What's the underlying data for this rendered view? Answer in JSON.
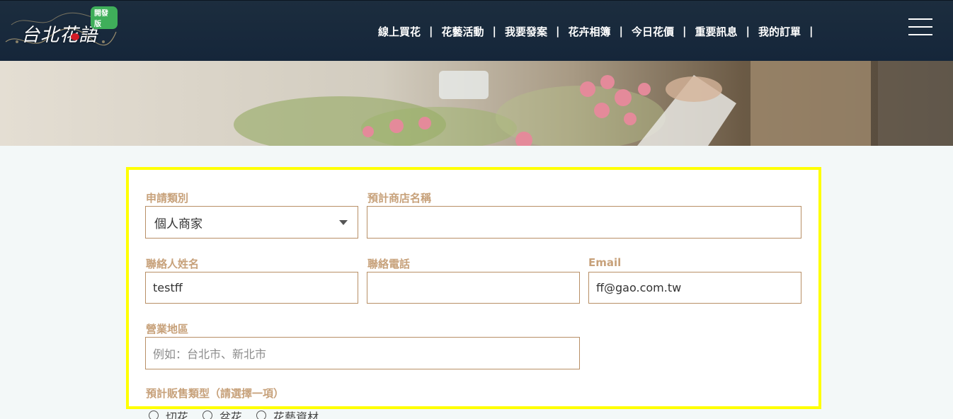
{
  "header": {
    "logo_text": "台北花語",
    "logo_badge": "開發版",
    "nav": [
      "線上買花",
      "花藝活動",
      "我要發案",
      "花卉相簿",
      "今日花價",
      "重要訊息",
      "我的訂單"
    ],
    "nav_separator": "|"
  },
  "form": {
    "apply_type": {
      "label": "申請類別",
      "value": "個人商家"
    },
    "store_name": {
      "label": "預計商店名稱",
      "value": ""
    },
    "contact_name": {
      "label": "聯絡人姓名",
      "value": "testff"
    },
    "contact_phone": {
      "label": "聯絡電話",
      "value": ""
    },
    "email": {
      "label": "Email",
      "value": "ff@gao.com.tw"
    },
    "business_area": {
      "label": "營業地區",
      "placeholder": "例如：台北市、新北市"
    },
    "sales_type": {
      "label": "預計販售類型（請選擇一項）",
      "options": [
        "切花",
        "盆花",
        "花藝資材"
      ]
    }
  },
  "colors": {
    "header_bg": "#1c2d3e",
    "label": "#c7a17a",
    "field_border": "#b88f66",
    "highlight": "#ffff00"
  }
}
